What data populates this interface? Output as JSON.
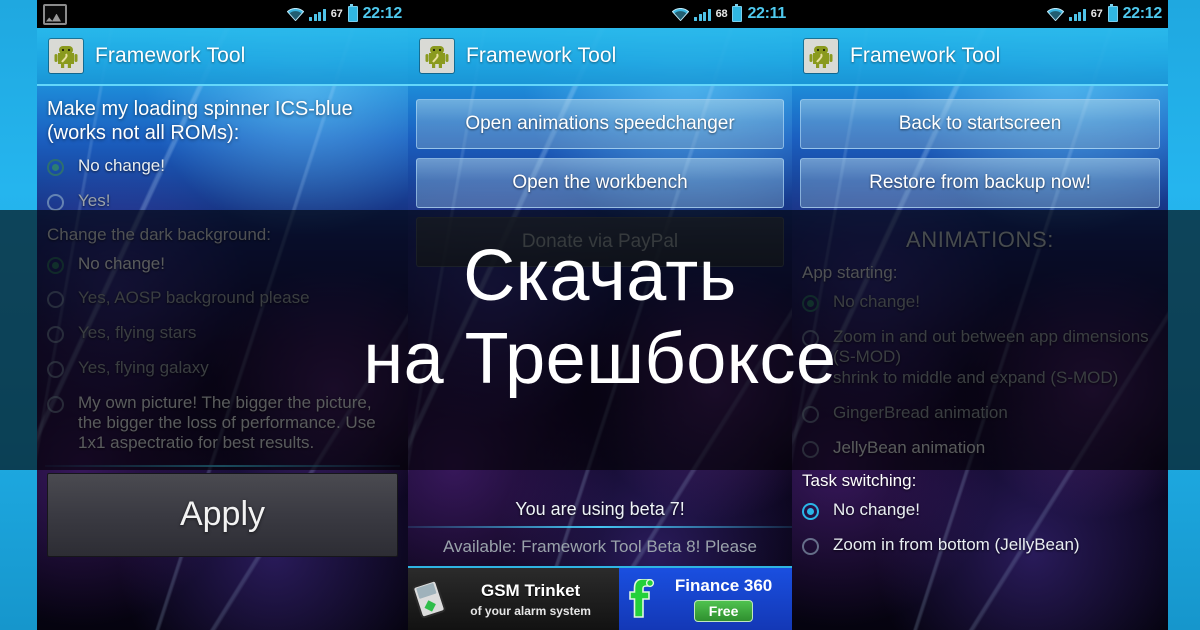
{
  "overlay": {
    "line1": "Скачать",
    "line2": "на Трешбоксе",
    "band_color": "#000000"
  },
  "app": {
    "name": "Framework Tool",
    "icon": "android-robot-icon"
  },
  "statusbar": {
    "picture_icon": "picture-icon",
    "wifi_icon": "wifi-icon",
    "signal_icon": "signal-bars-icon",
    "battery_icon": "battery-icon",
    "accent": "#4fc9ee"
  },
  "panels": [
    {
      "id": "panel-spinner-settings",
      "statusbar": {
        "battery": "67",
        "time": "22:12"
      },
      "headline": "Make my loading spinner ICS-blue (works not all ROMs):",
      "spinner_options": [
        {
          "label": "No change!",
          "selected": true
        },
        {
          "label": "Yes!",
          "selected": false
        }
      ],
      "section2_title": "Change the dark background:",
      "background_options": [
        {
          "label": "No change!",
          "selected": true
        },
        {
          "label": "Yes, AOSP background please",
          "selected": false
        },
        {
          "label": "Yes, flying stars",
          "selected": false
        },
        {
          "label": "Yes, flying galaxy",
          "selected": false
        },
        {
          "label": "My own picture! The bigger the picture, the bigger the loss of performance. Use 1x1 aspectratio for best results.",
          "selected": false
        }
      ],
      "apply_button": "Apply"
    },
    {
      "id": "panel-main-menu",
      "statusbar": {
        "battery": "68",
        "time": "22:11"
      },
      "buttons": [
        {
          "label": "Open animations speedchanger",
          "disabled": false
        },
        {
          "label": "Open the workbench",
          "disabled": false
        },
        {
          "label": "Donate via PayPal",
          "disabled": true
        }
      ],
      "beta_status": "You are using beta 7!",
      "beta_available": "Available: Framework Tool Beta 8! Please",
      "ad": {
        "left_title": "GSM Trinket",
        "left_subtitle": "of your alarm system",
        "left_icon": "phone-icon",
        "right_title": "Finance 360",
        "right_badge": "Free",
        "right_icon": "facebook-f-icon"
      }
    },
    {
      "id": "panel-animations",
      "statusbar": {
        "battery": "67",
        "time": "22:12"
      },
      "buttons": [
        {
          "label": "Back to startscreen",
          "disabled": false
        },
        {
          "label": "Restore from backup now!",
          "disabled": false
        }
      ],
      "section_title": "ANIMATIONS:",
      "app_starting_title": "App starting:",
      "app_starting_options": [
        {
          "label": "No change!",
          "selected": true
        },
        {
          "label": "Zoom in and out between app dimensions (S-MOD)",
          "selected": false
        },
        {
          "label": "shrink to middle and expand (S-MOD)",
          "selected": false
        },
        {
          "label": "GingerBread animation",
          "selected": false
        },
        {
          "label": "JellyBean animation",
          "selected": false
        }
      ],
      "task_switching_title": "Task switching:",
      "task_switching_options": [
        {
          "label": "No change!",
          "selected": true
        },
        {
          "label": "Zoom in from bottom (JellyBean)",
          "selected": false
        }
      ]
    }
  ]
}
